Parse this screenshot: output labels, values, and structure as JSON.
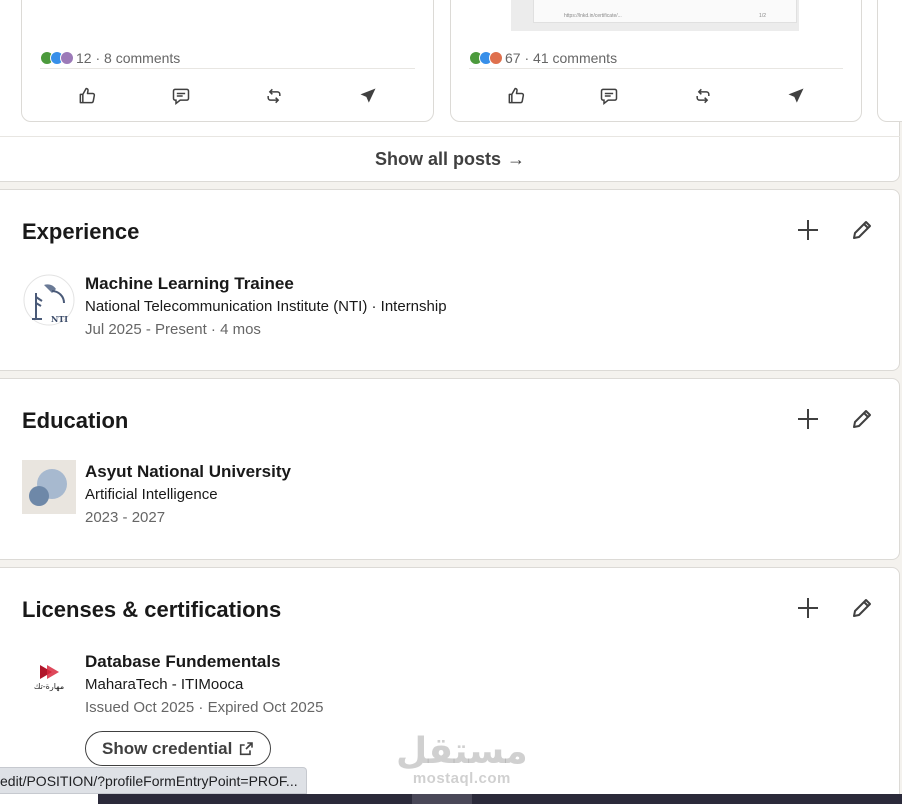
{
  "posts": [
    {
      "reaction_count": "12",
      "comments": "8 comments"
    },
    {
      "reaction_count": "67",
      "comments": "41 comments",
      "thumb_text": "https://lnkd.in/certificate/...",
      "thumb_page": "1/2"
    }
  ],
  "posts_separator": " · ",
  "show_all_label": "Show all posts",
  "show_all_arrow": "→",
  "experience": {
    "title": "Experience",
    "items": [
      {
        "role": "Machine Learning Trainee",
        "org": "National Telecommunication Institute (NTI) · Internship",
        "dates": "Jul 2025 - Present · 4 mos",
        "logo_text": "NTI"
      }
    ]
  },
  "education": {
    "title": "Education",
    "items": [
      {
        "school": "Asyut National University",
        "field": "Artificial Intelligence",
        "dates": "2023 - 2027"
      }
    ]
  },
  "licenses": {
    "title": "Licenses & certifications",
    "items": [
      {
        "name": "Database Fundementals",
        "issuer": "MaharaTech - ITIMooca",
        "dates": "Issued Oct 2025 · Expired Oct 2025",
        "logo_text": "مهارة-تك",
        "credential_label": "Show credential"
      }
    ]
  },
  "status_url": "edit/POSITION/?profileFormEntryPoint=PROF...",
  "watermark": {
    "arabic": "مستقل",
    "latin": "mostaql.com"
  },
  "colors": {
    "accent": "#0a66c2",
    "text_secondary": "#666666",
    "page_bg": "#f4f2ee"
  }
}
